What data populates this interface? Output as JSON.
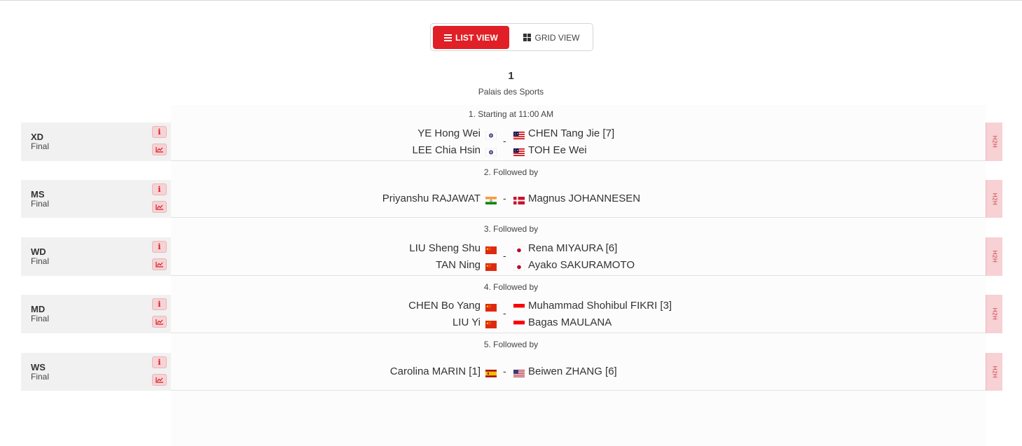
{
  "toggle": {
    "list_label": "LIST VIEW",
    "grid_label": "GRID VIEW"
  },
  "court": {
    "number": "1",
    "name": "Palais des Sports"
  },
  "colors": {
    "accent": "#e01f26",
    "h2h_bg": "#f7d1d4"
  },
  "slots": [
    "1. Starting at 11:00 AM",
    "2. Followed by",
    "3. Followed by",
    "4. Followed by",
    "5. Followed by"
  ],
  "matches": [
    {
      "event": "XD",
      "round": "Final",
      "h2h": "H2H",
      "left": [
        "YE Hong Wei",
        "LEE Chia Hsin"
      ],
      "left_flag": "tpe",
      "right": [
        "CHEN Tang Jie [7]",
        "TOH Ee Wei"
      ],
      "right_flag": "mas"
    },
    {
      "event": "MS",
      "round": "Final",
      "h2h": "H2H",
      "left": [
        "Priyanshu RAJAWAT"
      ],
      "left_flag": "ind",
      "right": [
        "Magnus JOHANNESEN"
      ],
      "right_flag": "den"
    },
    {
      "event": "WD",
      "round": "Final",
      "h2h": "H2H",
      "left": [
        "LIU Sheng Shu",
        "TAN Ning"
      ],
      "left_flag": "chn",
      "right": [
        "Rena MIYAURA [6]",
        "Ayako SAKURAMOTO"
      ],
      "right_flag": "jpn"
    },
    {
      "event": "MD",
      "round": "Final",
      "h2h": "H2H",
      "left": [
        "CHEN Bo Yang",
        "LIU Yi"
      ],
      "left_flag": "chn",
      "right": [
        "Muhammad Shohibul FIKRI [3]",
        "Bagas MAULANA"
      ],
      "right_flag": "ina"
    },
    {
      "event": "WS",
      "round": "Final",
      "h2h": "H2H",
      "left": [
        "Carolina MARIN [1]"
      ],
      "left_flag": "esp",
      "right": [
        "Beiwen ZHANG [6]"
      ],
      "right_flag": "usa"
    }
  ]
}
